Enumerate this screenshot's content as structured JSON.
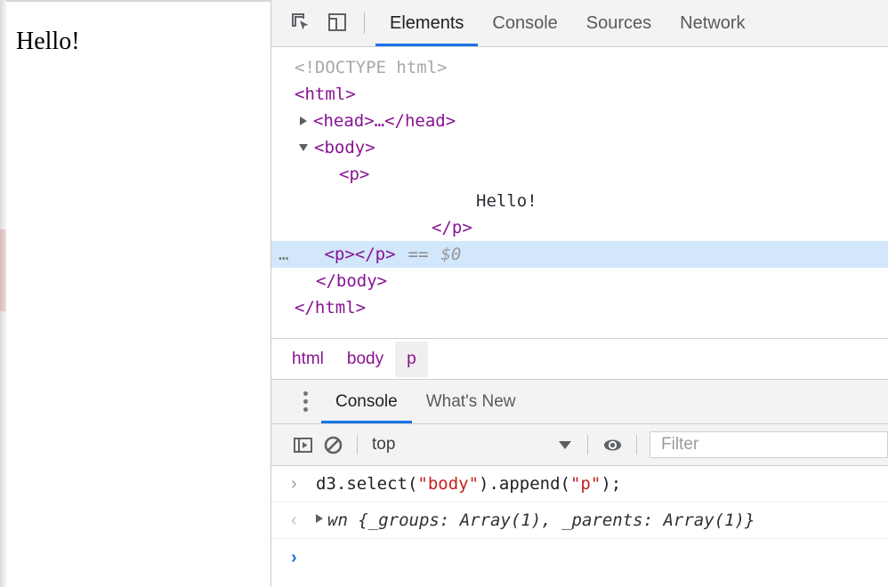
{
  "page": {
    "paragraph_text": "Hello!"
  },
  "devtools": {
    "toolbar": {
      "inspect_icon": "inspect-element-icon",
      "device_icon": "device-toolbar-icon"
    },
    "tabs": [
      {
        "label": "Elements",
        "active": true
      },
      {
        "label": "Console",
        "active": false
      },
      {
        "label": "Sources",
        "active": false
      },
      {
        "label": "Network",
        "active": false
      }
    ],
    "dom_tree": [
      {
        "indent": 1,
        "twisty": "none",
        "kind": "doctype",
        "text": "<!DOCTYPE html>"
      },
      {
        "indent": 1,
        "twisty": "none",
        "kind": "tag",
        "text": "<html>"
      },
      {
        "indent": 1,
        "twisty": "closed",
        "kind": "tag",
        "text": "<head>…</head>"
      },
      {
        "indent": 1,
        "twisty": "open",
        "kind": "tag",
        "text": "<body>"
      },
      {
        "indent": 3,
        "twisty": "none",
        "kind": "tag",
        "text": "<p>"
      },
      {
        "indent": 11,
        "twisty": "none",
        "kind": "text",
        "text": "Hello!"
      },
      {
        "indent": 8,
        "twisty": "none",
        "kind": "tag",
        "text": "</p>"
      },
      {
        "indent": 3,
        "twisty": "none",
        "kind": "selected",
        "text": "<p></p>",
        "dots": "…",
        "eq": "==",
        "dollar": "$0"
      },
      {
        "indent": 2,
        "twisty": "none",
        "kind": "tag",
        "text": "</body>"
      },
      {
        "indent": 1,
        "twisty": "none",
        "kind": "tag",
        "text": "</html>"
      }
    ],
    "breadcrumbs": [
      {
        "label": "html",
        "active": false
      },
      {
        "label": "body",
        "active": false
      },
      {
        "label": "p",
        "active": true
      }
    ],
    "drawer": {
      "menu_icon": "kebab-menu-icon",
      "tabs": [
        {
          "label": "Console",
          "active": true
        },
        {
          "label": "What's New",
          "active": false
        }
      ]
    },
    "console_toolbar": {
      "sidebar_icon": "console-sidebar-icon",
      "clear_icon": "clear-console-icon",
      "context": "top",
      "eye_icon": "live-expression-eye-icon",
      "filter_placeholder": "Filter"
    },
    "console_log": [
      {
        "gutter": "›",
        "type": "input",
        "segments": [
          {
            "t": "d3.select(",
            "cls": "code-js"
          },
          {
            "t": "\"body\"",
            "cls": "str"
          },
          {
            "t": ").append(",
            "cls": "code-js"
          },
          {
            "t": "\"p\"",
            "cls": "str"
          },
          {
            "t": ");",
            "cls": "code-js"
          }
        ]
      },
      {
        "gutter": "‹",
        "type": "output",
        "expandable": true,
        "text": "wn {_groups: Array(1), _parents: Array(1)}"
      },
      {
        "gutter": "›",
        "type": "prompt",
        "text": ""
      }
    ]
  },
  "colors": {
    "accent": "#1a73e8",
    "tag": "#881391",
    "string": "#c5221f",
    "selected_row": "#d2e6fc",
    "chrome_bg": "#f3f3f3"
  }
}
